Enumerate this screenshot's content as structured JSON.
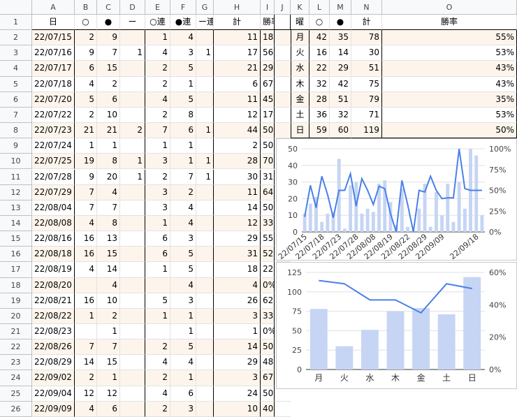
{
  "columns": [
    "A",
    "B",
    "C",
    "D",
    "E",
    "F",
    "G",
    "H",
    "I",
    "J",
    "K",
    "L",
    "M",
    "N",
    "O",
    "P"
  ],
  "header_row": [
    "日",
    "○",
    "●",
    "ー",
    "○連",
    "●連",
    "ー連",
    "計",
    "勝率",
    "",
    "曜",
    "○",
    "●",
    "計",
    "勝率"
  ],
  "rows": [
    [
      "22/07/15",
      "2",
      "9",
      "",
      "1",
      "4",
      "",
      "11",
      "18%"
    ],
    [
      "22/07/16",
      "9",
      "7",
      "1",
      "4",
      "3",
      "1",
      "17",
      "56%"
    ],
    [
      "22/07/17",
      "6",
      "15",
      "",
      "2",
      "5",
      "",
      "21",
      "29%"
    ],
    [
      "22/07/18",
      "4",
      "2",
      "",
      "2",
      "1",
      "",
      "6",
      "67%"
    ],
    [
      "22/07/20",
      "5",
      "6",
      "",
      "4",
      "5",
      "",
      "11",
      "45%"
    ],
    [
      "22/07/22",
      "2",
      "10",
      "",
      "2",
      "8",
      "",
      "12",
      "17%"
    ],
    [
      "22/07/23",
      "21",
      "21",
      "2",
      "7",
      "6",
      "1",
      "44",
      "50%"
    ],
    [
      "22/07/24",
      "1",
      "1",
      "",
      "1",
      "1",
      "",
      "2",
      "50%"
    ],
    [
      "22/07/25",
      "19",
      "8",
      "1",
      "3",
      "1",
      "1",
      "28",
      "70%"
    ],
    [
      "22/07/28",
      "9",
      "20",
      "1",
      "2",
      "7",
      "1",
      "30",
      "31%"
    ],
    [
      "22/07/29",
      "7",
      "4",
      "",
      "3",
      "2",
      "",
      "11",
      "64%"
    ],
    [
      "22/08/04",
      "7",
      "7",
      "",
      "3",
      "4",
      "",
      "14",
      "50%"
    ],
    [
      "22/08/08",
      "4",
      "8",
      "",
      "1",
      "4",
      "",
      "12",
      "33%"
    ],
    [
      "22/08/16",
      "16",
      "13",
      "",
      "6",
      "3",
      "",
      "29",
      "55%"
    ],
    [
      "22/08/18",
      "16",
      "15",
      "",
      "6",
      "5",
      "",
      "31",
      "52%"
    ],
    [
      "22/08/19",
      "4",
      "14",
      "",
      "1",
      "5",
      "",
      "18",
      "22%"
    ],
    [
      "22/08/20",
      "",
      "4",
      "",
      "",
      "4",
      "",
      "4",
      "0%"
    ],
    [
      "22/08/21",
      "16",
      "10",
      "",
      "5",
      "3",
      "",
      "26",
      "62%"
    ],
    [
      "22/08/22",
      "1",
      "2",
      "",
      "1",
      "1",
      "",
      "3",
      "33%"
    ],
    [
      "22/08/23",
      "",
      "1",
      "",
      "",
      "1",
      "",
      "1",
      "0%"
    ],
    [
      "22/08/26",
      "7",
      "7",
      "",
      "2",
      "5",
      "",
      "14",
      "50%"
    ],
    [
      "22/08/29",
      "14",
      "15",
      "",
      "4",
      "4",
      "",
      "29",
      "48%"
    ],
    [
      "22/09/02",
      "2",
      "1",
      "",
      "2",
      "1",
      "",
      "3",
      "67%"
    ],
    [
      "22/09/04",
      "12",
      "12",
      "",
      "4",
      "6",
      "",
      "24",
      "50%"
    ],
    [
      "22/09/09",
      "4",
      "6",
      "",
      "2",
      "3",
      "",
      "10",
      "40%"
    ]
  ],
  "weekday_table": [
    [
      "月",
      "42",
      "35",
      "78",
      "55%"
    ],
    [
      "火",
      "16",
      "14",
      "30",
      "53%"
    ],
    [
      "水",
      "22",
      "29",
      "51",
      "43%"
    ],
    [
      "木",
      "32",
      "42",
      "75",
      "43%"
    ],
    [
      "金",
      "28",
      "51",
      "79",
      "35%"
    ],
    [
      "土",
      "36",
      "32",
      "71",
      "53%"
    ],
    [
      "日",
      "59",
      "60",
      "119",
      "50%"
    ]
  ],
  "chart_data": [
    {
      "type": "bar+line",
      "title": "",
      "x": [
        "22/07/15",
        "22/07/16",
        "22/07/17",
        "22/07/18",
        "22/07/20",
        "22/07/22",
        "22/07/23",
        "22/07/24",
        "22/07/25",
        "22/07/28",
        "22/07/29",
        "22/08/04",
        "22/08/08",
        "22/08/16",
        "22/08/18",
        "22/08/19",
        "22/08/20",
        "22/08/21",
        "22/08/22",
        "22/08/23",
        "22/08/26",
        "22/08/29",
        "22/09/02",
        "22/09/04",
        "22/09/09",
        "22/09/10",
        "22/09/11",
        "22/09/14",
        "22/09/16",
        "22/09/17",
        "22/09/18",
        "22/09/19"
      ],
      "x_tick_labels": [
        "22/07/15",
        "22/07/18",
        "22/07/23",
        "22/07/28",
        "22/08/08",
        "22/08/19",
        "22/08/22",
        "22/08/29",
        "22/09/09",
        "22/09/18"
      ],
      "bars": [
        11,
        17,
        21,
        6,
        11,
        12,
        44,
        2,
        28,
        30,
        11,
        14,
        12,
        29,
        31,
        18,
        4,
        26,
        3,
        1,
        14,
        29,
        3,
        24,
        10,
        29,
        6,
        30,
        14,
        50,
        46,
        10
      ],
      "line": [
        18,
        56,
        29,
        67,
        45,
        17,
        50,
        50,
        70,
        31,
        64,
        50,
        33,
        55,
        52,
        22,
        0,
        62,
        33,
        0,
        50,
        48,
        67,
        50,
        40,
        41,
        41,
        100,
        52,
        50,
        50,
        50
      ],
      "ylim_left": [
        0,
        50
      ],
      "yticks_left": [
        "0",
        "10",
        "20",
        "30",
        "40",
        "50"
      ],
      "ylim_right": [
        0,
        100
      ],
      "yticks_right": [
        "0%",
        "25%",
        "50%",
        "75%",
        "100%"
      ],
      "bar_color": "#c6d5f3",
      "line_color": "#4a80e8"
    },
    {
      "type": "bar+line",
      "title": "",
      "categories": [
        "月",
        "火",
        "水",
        "木",
        "金",
        "土",
        "日"
      ],
      "bars": [
        78,
        30,
        51,
        75,
        79,
        71,
        119
      ],
      "line": [
        55,
        53,
        43,
        43,
        35,
        53,
        50
      ],
      "ylim_left": [
        0,
        125
      ],
      "yticks_left": [
        "0",
        "25",
        "50",
        "75",
        "100",
        "125"
      ],
      "ylim_right": [
        0,
        60
      ],
      "yticks_right": [
        "0%",
        "20%",
        "40%",
        "60%"
      ],
      "bar_color": "#c6d5f3",
      "line_color": "#4a80e8"
    }
  ]
}
